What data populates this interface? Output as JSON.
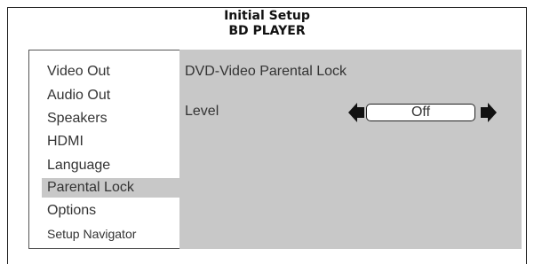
{
  "header": {
    "title": "Initial Setup",
    "subtitle": "BD PLAYER"
  },
  "sidebar": {
    "items": [
      {
        "label": "Video Out",
        "selected": false
      },
      {
        "label": "Audio Out",
        "selected": false
      },
      {
        "label": "Speakers",
        "selected": false
      },
      {
        "label": "HDMI",
        "selected": false
      },
      {
        "label": "Language",
        "selected": false
      },
      {
        "label": "Parental Lock",
        "selected": true
      },
      {
        "label": "Options",
        "selected": false
      },
      {
        "label": "Setup Navigator",
        "selected": false
      }
    ]
  },
  "content": {
    "title": "DVD-Video Parental Lock",
    "level_label": "Level",
    "level_value": "Off",
    "left_arrow_icon": "left-arrow-icon",
    "right_arrow_icon": "right-arrow-icon"
  },
  "colors": {
    "panel_bg": "#c8c8c8",
    "highlight_bg": "#c8c8c8",
    "text": "#333333",
    "frame": "#222222"
  }
}
